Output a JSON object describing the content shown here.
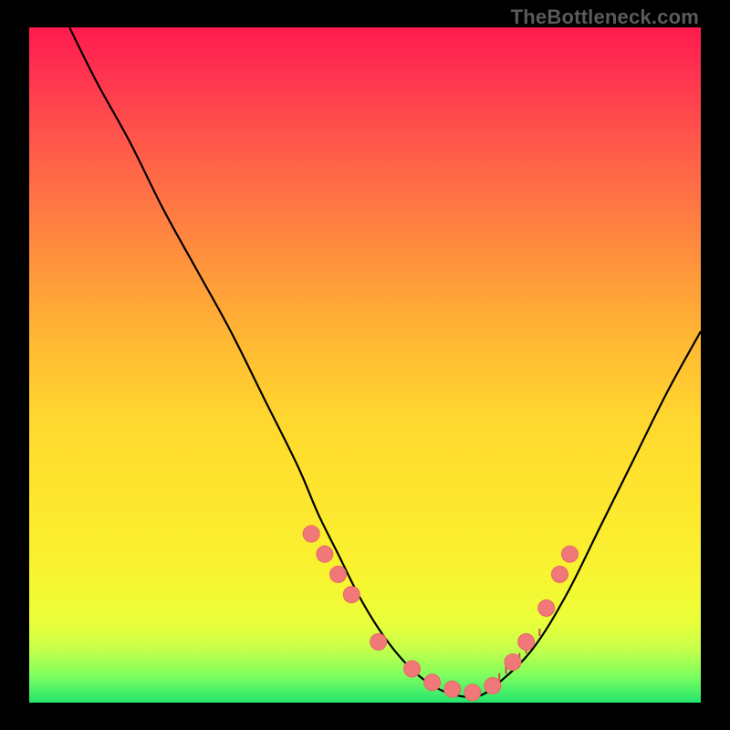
{
  "watermark": "TheBottleneck.com",
  "colors": {
    "frame_bg": "#000000",
    "dot": "#f07878",
    "curve": "#000000"
  },
  "chart_data": {
    "type": "line",
    "title": "",
    "xlabel": "",
    "ylabel": "",
    "xlim": [
      0,
      100
    ],
    "ylim": [
      0,
      100
    ],
    "grid": false,
    "legend": false,
    "series": [
      {
        "name": "bottleneck-curve",
        "x": [
          6,
          10,
          15,
          20,
          25,
          30,
          35,
          40,
          43,
          46,
          49,
          52,
          55,
          58,
          61,
          64,
          67,
          70,
          75,
          80,
          85,
          90,
          95,
          100
        ],
        "y": [
          100,
          92,
          83,
          73,
          64,
          55,
          45,
          35,
          28,
          22,
          16,
          11,
          7,
          4,
          2,
          1,
          1,
          3,
          8,
          16,
          26,
          36,
          46,
          55
        ]
      }
    ],
    "markers": {
      "name": "highlight-dots",
      "x": [
        42,
        44,
        46,
        48,
        52,
        57,
        60,
        63,
        66,
        69,
        72,
        74,
        77,
        79,
        80.5
      ],
      "y": [
        25,
        22,
        19,
        16,
        9,
        5,
        3,
        2,
        1.5,
        2.5,
        6,
        9,
        14,
        19,
        22
      ]
    },
    "ticks": {
      "name": "fit-ticks",
      "x": [
        68,
        69,
        70,
        71,
        72,
        73,
        74,
        75,
        76
      ]
    }
  }
}
